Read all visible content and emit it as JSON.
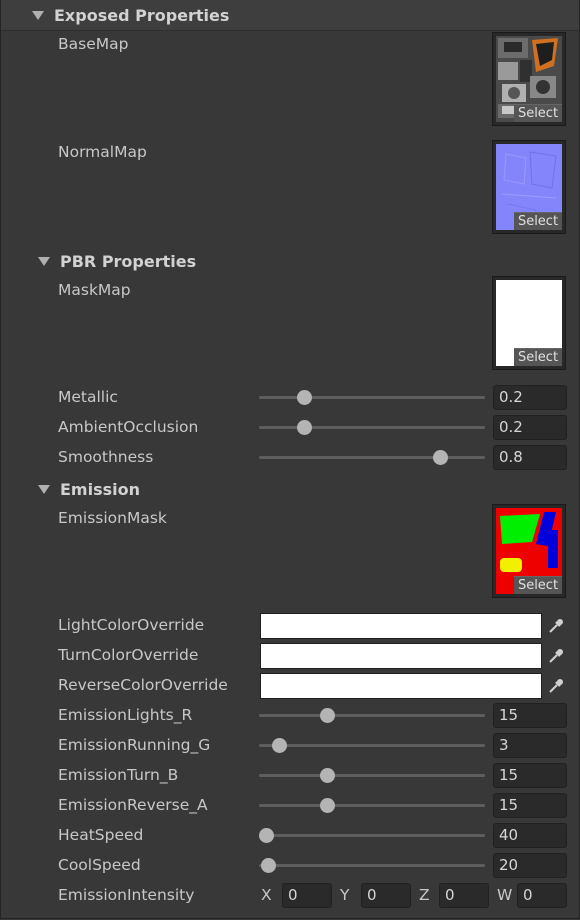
{
  "sections": {
    "exposed": {
      "title": "Exposed Properties"
    },
    "pbr": {
      "title": "PBR Properties"
    },
    "emission": {
      "title": "Emission"
    }
  },
  "textures": {
    "base_map": {
      "label": "BaseMap",
      "select_label": "Select"
    },
    "normal_map": {
      "label": "NormalMap",
      "select_label": "Select"
    },
    "mask_map": {
      "label": "MaskMap",
      "select_label": "Select"
    },
    "emission_mask": {
      "label": "EmissionMask",
      "select_label": "Select"
    }
  },
  "pbr_sliders": [
    {
      "label": "Metallic",
      "value": "0.2",
      "fraction": 0.2
    },
    {
      "label": "AmbientOcclusion",
      "value": "0.2",
      "fraction": 0.2
    },
    {
      "label": "Smoothness",
      "value": "0.8",
      "fraction": 0.8
    }
  ],
  "color_overrides": [
    {
      "label": "LightColorOverride",
      "color": "#ffffff"
    },
    {
      "label": "TurnColorOverride",
      "color": "#ffffff"
    },
    {
      "label": "ReverseColorOverride",
      "color": "#ffffff"
    }
  ],
  "emission_sliders": [
    {
      "label": "EmissionLights_R",
      "value": "15",
      "fraction": 0.3
    },
    {
      "label": "EmissionRunning_G",
      "value": "3",
      "fraction": 0.09
    },
    {
      "label": "EmissionTurn_B",
      "value": "15",
      "fraction": 0.3
    },
    {
      "label": "EmissionReverse_A",
      "value": "15",
      "fraction": 0.3
    },
    {
      "label": "HeatSpeed",
      "value": "40",
      "fraction": 0.03
    },
    {
      "label": "CoolSpeed",
      "value": "20",
      "fraction": 0.04
    }
  ],
  "emission_intensity": {
    "label": "EmissionIntensity",
    "x_label": "X",
    "x": "0",
    "y_label": "Y",
    "y": "0",
    "z_label": "Z",
    "z": "0",
    "w_label": "W",
    "w": "0"
  },
  "icons": {
    "picker": "eyedropper-icon",
    "foldout": "triangle-down-icon"
  }
}
